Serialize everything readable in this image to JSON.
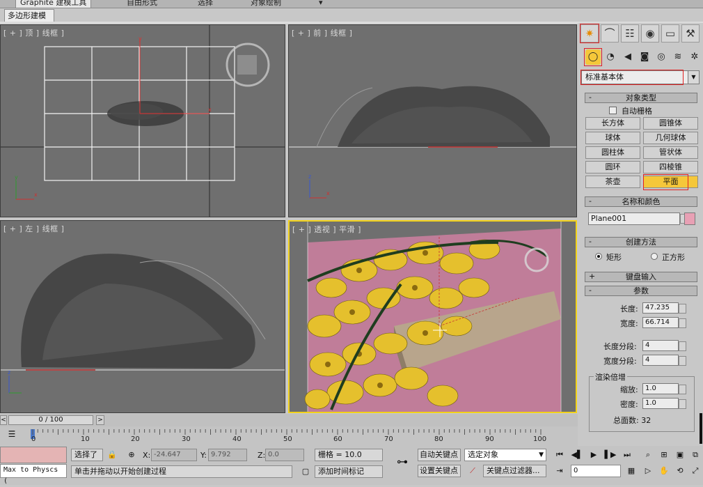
{
  "ribbon": {
    "tabs": [
      "Graphite 建模工具",
      "自由形式",
      "选择",
      "对象绘制"
    ],
    "extra": "▾",
    "subtab": "多边形建模"
  },
  "viewports": {
    "top_label": "[ + ] 顶 ] 线框 ]",
    "front_label": "[ + ] 前 ] 线框 ]",
    "left_label": "[ + ] 左 ] 线框 ]",
    "persp_label": "[ + ] 透视 ] 平滑 ]",
    "bg_color": "#6f6f6f",
    "plane_color": "#c07d99",
    "flower_color": "#e5c02d",
    "active_border": "#f2d21a"
  },
  "command_panel": {
    "tabs": [
      "create-icon",
      "modify-icon",
      "hierarchy-icon",
      "motion-icon",
      "display-icon",
      "utilities-icon"
    ],
    "subcategories": [
      "geometry-icon",
      "shapes-icon",
      "lights-icon",
      "cameras-icon",
      "helpers-icon",
      "spacewarps-icon",
      "systems-icon"
    ],
    "category_value": "标准基本体",
    "object_type": {
      "title": "对象类型",
      "autogrid_label": "自动栅格",
      "buttons": [
        "长方体",
        "圆锥体",
        "球体",
        "几何球体",
        "圆柱体",
        "管状体",
        "圆环",
        "四棱锥",
        "茶壶",
        "平面"
      ]
    },
    "name_color": {
      "title": "名称和颜色",
      "name_value": "Plane001",
      "swatch_color": "#e8a0b4"
    },
    "creation_method": {
      "title": "创建方法",
      "option_rect": "矩形",
      "option_square": "正方形"
    },
    "keyboard_entry": {
      "title": "键盘输入"
    },
    "parameters": {
      "title": "参数",
      "length_label": "长度:",
      "length_value": "47.235",
      "width_label": "宽度:",
      "width_value": "66.714",
      "length_segs_label": "长度分段:",
      "length_segs_value": "4",
      "width_segs_label": "宽度分段:",
      "width_segs_value": "4",
      "render_group": "渲染倍增",
      "scale_label": "缩放:",
      "scale_value": "1.0",
      "density_label": "密度:",
      "density_value": "1.0",
      "total_faces": "总面数: 32"
    }
  },
  "timeline": {
    "position": "0 / 100",
    "frame_fraction": 0.0,
    "ticks": [
      "0",
      "10",
      "20",
      "30",
      "40",
      "50",
      "60",
      "70",
      "80",
      "90",
      "100"
    ]
  },
  "status": {
    "maxscript": "Max to Physcs (",
    "selection": "选择了",
    "x_label": "X:",
    "x_value": "-24.647",
    "y_label": "Y:",
    "y_value": "9.792",
    "z_label": "Z:",
    "z_value": "0.0",
    "grid": "栅格 = 10.0",
    "prompt": "单击并拖动以开始创建过程",
    "add_time_tag": "添加时间标记",
    "auto_key": "自动关键点",
    "set_key": "设置关键点",
    "key_mode_value": "选定对象",
    "key_filters": "关键点过滤器...",
    "current_frame": "0"
  }
}
